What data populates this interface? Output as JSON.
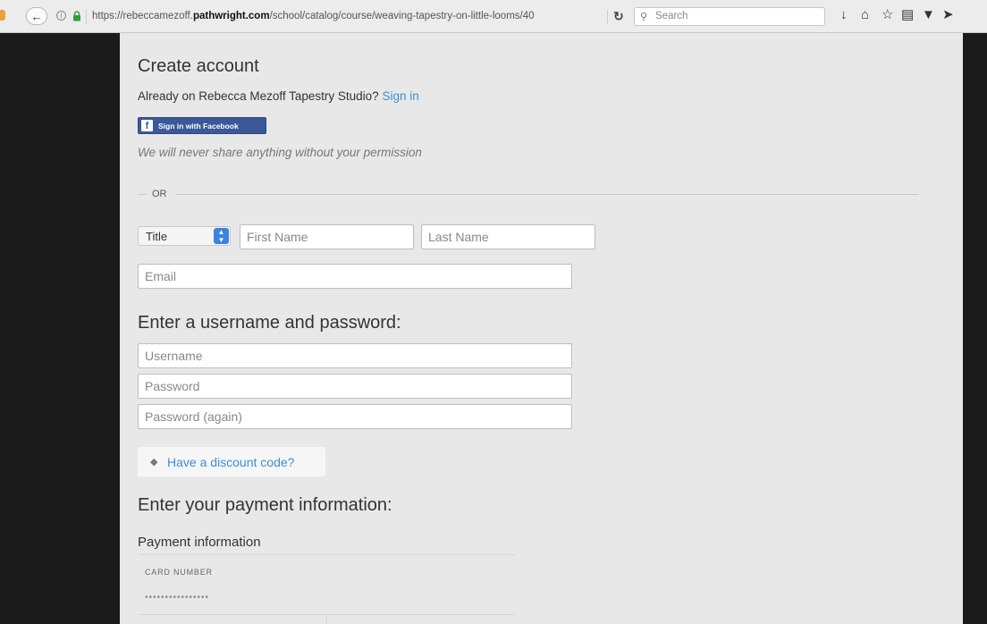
{
  "browser": {
    "url_prefix": "https://rebeccamezoff.",
    "url_domain": "pathwright.com",
    "url_path": "/school/catalog/course/weaving-tapestry-on-little-looms/40",
    "search_placeholder": "Search"
  },
  "form": {
    "heading": "Create account",
    "already_text": "Already on Rebecca Mezoff Tapestry Studio?",
    "sign_in_link": "Sign in",
    "facebook_button": "Sign in with Facebook",
    "privacy_note": "We will never share anything without your permission",
    "or_divider": "OR",
    "title_select": "Title",
    "first_name_placeholder": "First Name",
    "last_name_placeholder": "Last Name",
    "email_placeholder": "Email",
    "credentials_heading": "Enter a username and password:",
    "username_placeholder": "Username",
    "password_placeholder": "Password",
    "password_again_placeholder": "Password (again)",
    "discount_link": "Have a discount code?",
    "payment_heading": "Enter your payment information:",
    "payment_info_label": "Payment information",
    "card_number_label": "CARD NUMBER",
    "card_number_mask": "••••••••••••••••"
  },
  "colors": {
    "link": "#3c8fd6",
    "facebook": "#3b5998",
    "page_background": "#e8e8e8"
  }
}
